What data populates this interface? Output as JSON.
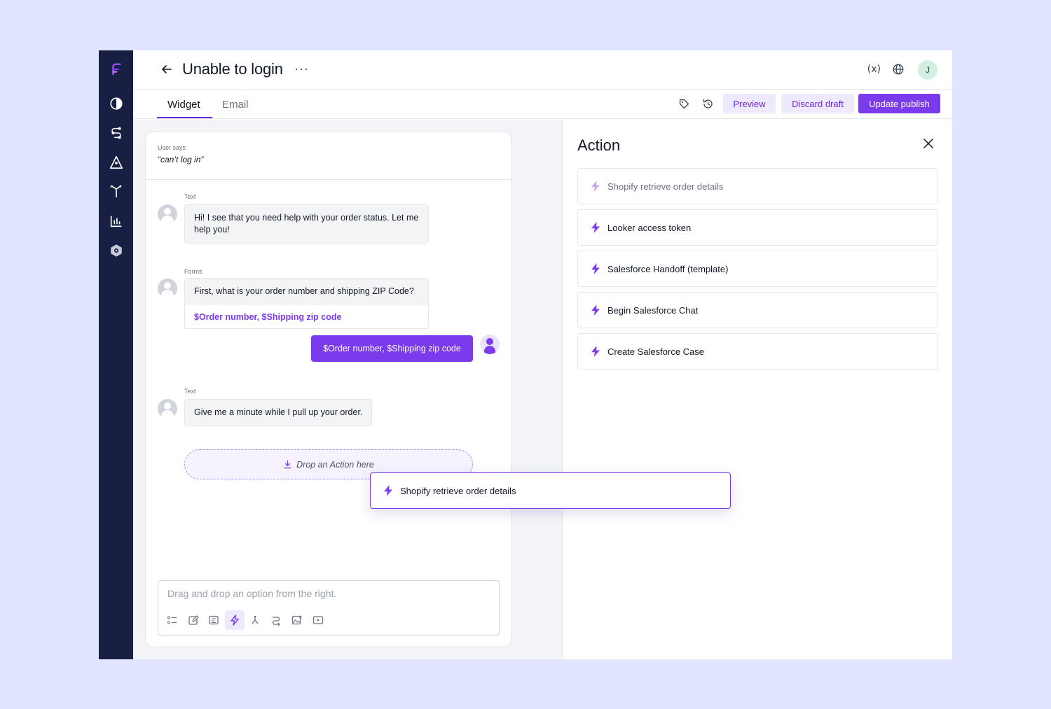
{
  "header": {
    "title": "Unable to login",
    "more": "···",
    "variables_label": "(x)",
    "avatar_initial": "J"
  },
  "tabs": {
    "widget": "Widget",
    "email": "Email"
  },
  "toolbar": {
    "preview": "Preview",
    "discard": "Discard draft",
    "update": "Update publish"
  },
  "chat": {
    "user_says_label": "User says",
    "user_says_text": "“can’t log in”",
    "messages": [
      {
        "type": "Text",
        "text": "Hi! I see that you need help with your order status. Let me help you!"
      },
      {
        "type": "Forms",
        "question": "First, what is your order number and shipping ZIP Code?",
        "variables": "$Order number, $Shipping zip code"
      },
      {
        "type": "Text",
        "text": "Give me a minute while I pull up your order."
      }
    ],
    "user_reply": "$Order number, $Shipping zip code",
    "dropzone": "Drop an Action here",
    "composer_placeholder": "Drag and drop an option from the right."
  },
  "panel": {
    "title": "Action",
    "actions": [
      "Shopify retrieve order details",
      "Looker access token",
      "Salesforce Handoff (template)",
      "Begin Salesforce Chat",
      "Create Salesforce Case"
    ]
  },
  "drag_item": "Shopify retrieve order details",
  "colors": {
    "brand": "#7c3aed",
    "sidebar": "#172043",
    "page_bg": "#e1e5fd"
  }
}
